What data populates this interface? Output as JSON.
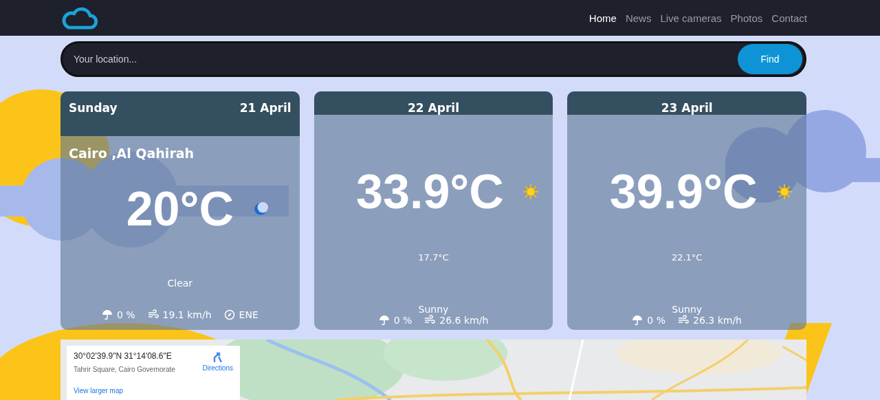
{
  "nav": {
    "items": [
      {
        "label": "Home",
        "selected": true
      },
      {
        "label": "News",
        "selected": false
      },
      {
        "label": "Live cameras",
        "selected": false
      },
      {
        "label": "Photos",
        "selected": false
      },
      {
        "label": "Contact",
        "selected": false
      }
    ]
  },
  "search": {
    "placeholder": "Your location...",
    "button": "Find"
  },
  "forecast": [
    {
      "day": "Sunday",
      "date": "21 April",
      "location": "Cairo ,Al Qahirah",
      "temperature": "20°C",
      "kind": "night",
      "condition": "Clear",
      "rain": "0 %",
      "wind": "19.1 km/h",
      "direction": "ENE"
    },
    {
      "date": "22 April",
      "temperature": "33.9°C",
      "kind": "day",
      "min_temperature": "17.7°C",
      "condition": "Sunny",
      "rain": "0 %",
      "wind": "26.6 km/h"
    },
    {
      "date": "23 April",
      "temperature": "39.9°C",
      "kind": "day",
      "min_temperature": "22.1°C",
      "condition": "Sunny",
      "rain": "0 %",
      "wind": "26.3 km/h"
    }
  ],
  "map": {
    "coordinates": "30°02'39.9\"N 31°14'08.6\"E",
    "address": "Tahrir Square, Cairo Governorate",
    "directions": "Directions",
    "larger_map": "View larger map"
  }
}
